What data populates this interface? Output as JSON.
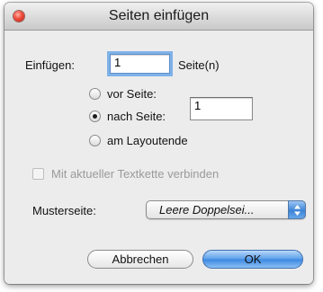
{
  "dialog": {
    "title": "Seiten einfügen",
    "einfuegen_label": "Einfügen:",
    "count_value": "1",
    "count_unit": "Seite(n)",
    "position_options": [
      {
        "label": "vor Seite:",
        "selected": false
      },
      {
        "label": "nach Seite:",
        "selected": true
      },
      {
        "label": "am Layoutende",
        "selected": false
      }
    ],
    "page_number_value": "1",
    "link_text_frame_label": "Mit aktueller Textkette verbinden",
    "link_text_frame_checked": false,
    "master_page_label": "Musterseite:",
    "master_page_value": "Leere Doppelsei...",
    "cancel_label": "Abbrechen",
    "ok_label": "OK"
  },
  "colors": {
    "accent": "#3a87e0",
    "close_button": "#f04a3a",
    "focus_ring": "#7fb2e8"
  }
}
